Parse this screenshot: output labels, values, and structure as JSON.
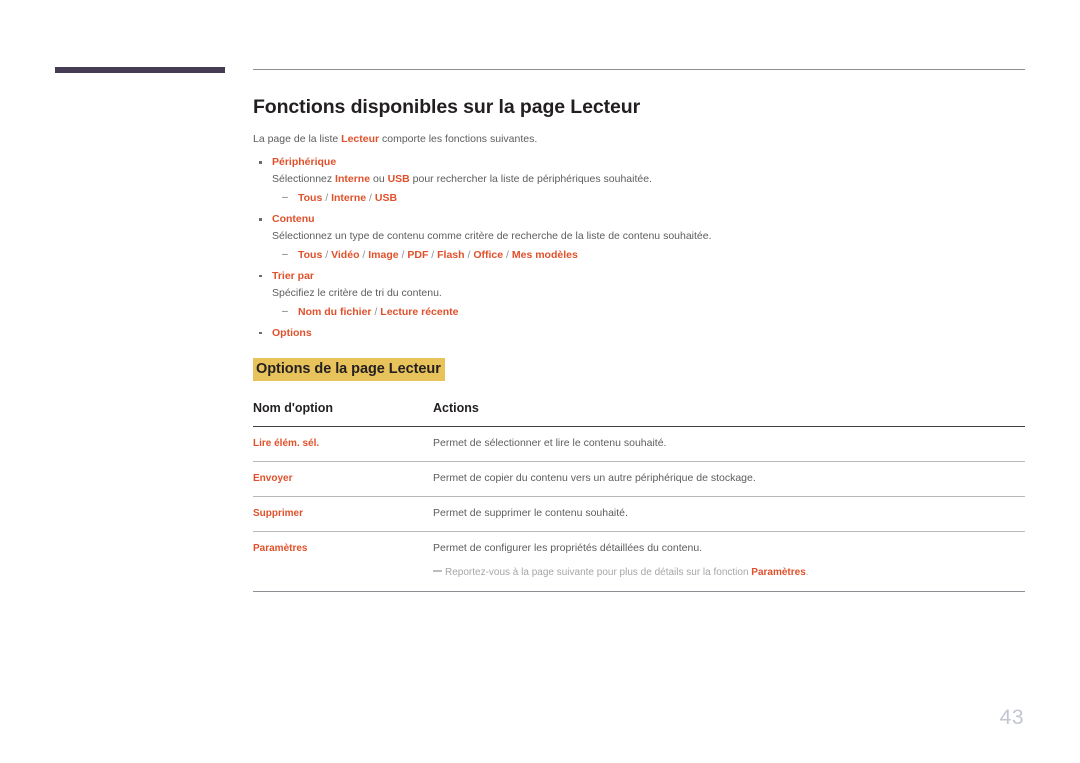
{
  "header": {
    "accent_bar_color": "#463c54",
    "rule_color": "#8d8d93"
  },
  "page": {
    "title": "Fonctions disponibles sur la page Lecteur",
    "number": "43",
    "accent_color": "#e0512b",
    "highlight_color": "#e8c25a",
    "body_color": "#5d5d5d"
  },
  "intro": {
    "before": "La page de la liste ",
    "highlight": "Lecteur",
    "after": " comporte les fonctions suivantes."
  },
  "bullets": [
    {
      "title": "Périphérique",
      "desc_before": "Sélectionnez ",
      "desc_hl1": "Interne",
      "desc_mid": " ou ",
      "desc_hl2": "USB",
      "desc_after": " pour rechercher la liste de périphériques souhaitée.",
      "options": [
        "Tous",
        "Interne",
        "USB"
      ]
    },
    {
      "title": "Contenu",
      "desc_before": "Sélectionnez un type de contenu comme critère de recherche de la liste de contenu souhaitée.",
      "desc_hl1": "",
      "desc_mid": "",
      "desc_hl2": "",
      "desc_after": "",
      "options": [
        "Tous",
        "Vidéo",
        "Image",
        "PDF",
        "Flash",
        "Office",
        "Mes modèles"
      ]
    },
    {
      "title": "Trier par",
      "desc_before": "Spécifiez le critère de tri du contenu.",
      "desc_hl1": "",
      "desc_mid": "",
      "desc_hl2": "",
      "desc_after": "",
      "options": [
        "Nom du fichier",
        "Lecture récente"
      ]
    },
    {
      "title": "Options",
      "desc_before": "",
      "desc_hl1": "",
      "desc_mid": "",
      "desc_hl2": "",
      "desc_after": "",
      "options": []
    }
  ],
  "section": {
    "heading": "Options de la page Lecteur"
  },
  "table": {
    "headers": [
      "Nom d'option",
      "Actions"
    ],
    "rows": [
      {
        "name": "Lire élém. sél.",
        "action": "Permet de sélectionner et lire le contenu souhaité.",
        "note_before": "",
        "note_hl": "",
        "note_after": ""
      },
      {
        "name": "Envoyer",
        "action": "Permet de copier du contenu vers un autre périphérique de stockage.",
        "note_before": "",
        "note_hl": "",
        "note_after": ""
      },
      {
        "name": "Supprimer",
        "action": "Permet de supprimer le contenu souhaité.",
        "note_before": "",
        "note_hl": "",
        "note_after": ""
      },
      {
        "name": "Paramètres",
        "action": "Permet de configurer les propriétés détaillées du contenu.",
        "note_before": "Reportez-vous à la page suivante pour plus de détails sur la fonction ",
        "note_hl": "Paramètres",
        "note_after": "."
      }
    ]
  }
}
